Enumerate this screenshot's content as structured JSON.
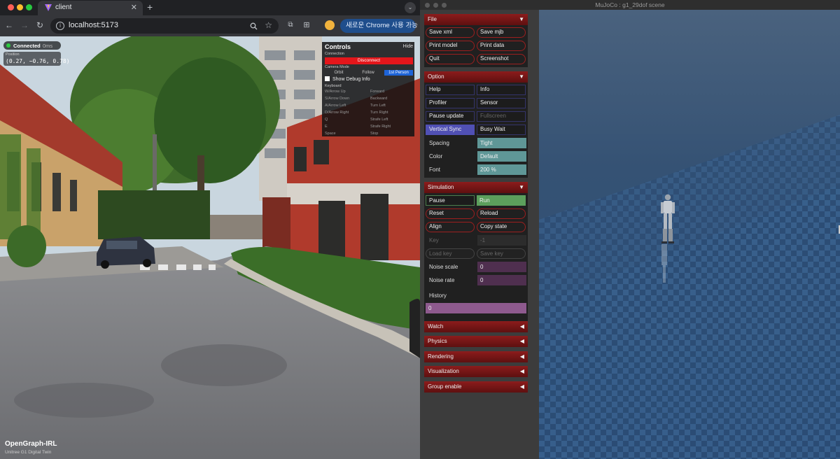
{
  "browser": {
    "tab_title": "client",
    "url": "localhost:5173",
    "update_button": "새로운 Chrome 사용 가능"
  },
  "app": {
    "status": {
      "label": "Connected",
      "latency": "0ms"
    },
    "position": {
      "label": "Position",
      "value": "(0.27, −0.76, 0.78)"
    },
    "controls": {
      "title": "Controls",
      "hide": "Hide",
      "connection_label": "Connection",
      "disconnect": "Disconnect",
      "camera_mode_label": "Camera Mode",
      "camera_modes": [
        "Orbit",
        "Follow",
        "1st Person"
      ],
      "active_camera": "1st Person",
      "debug_label": "Show Debug Info",
      "keyboard_label": "Keyboard",
      "keys": [
        {
          "key": "W/Arrow Up",
          "action": "Forward"
        },
        {
          "key": "S/Arrow Down",
          "action": "Backward"
        },
        {
          "key": "A/Arrow Left",
          "action": "Turn Left"
        },
        {
          "key": "D/Arrow Right",
          "action": "Turn Right"
        },
        {
          "key": "Q",
          "action": "Strafe Left"
        },
        {
          "key": "E",
          "action": "Strafe Right"
        },
        {
          "key": "Space",
          "action": "Stop"
        }
      ]
    },
    "brand": "OpenGraph-IRL",
    "brand_sub": "Unitree G1 Digital Twin"
  },
  "mujoco": {
    "window_title": "MuJoCo : g1_29dof scene",
    "file": {
      "header": "File",
      "buttons": [
        "Save xml",
        "Save mjb",
        "Print model",
        "Print data",
        "Quit",
        "Screenshot"
      ]
    },
    "option": {
      "header": "Option",
      "toggles": [
        "Help",
        "Info",
        "Profiler",
        "Sensor",
        "Pause update",
        "Fullscreen",
        "Vertical Sync",
        "Busy Wait"
      ],
      "spacing_label": "Spacing",
      "spacing_value": "Tight",
      "color_label": "Color",
      "color_value": "Default",
      "font_label": "Font",
      "font_value": "200 %"
    },
    "simulation": {
      "header": "Simulation",
      "pause": "Pause",
      "run": "Run",
      "reset": "Reset",
      "reload": "Reload",
      "align": "Align",
      "copy_state": "Copy state",
      "key_label": "Key",
      "key_value": "-1",
      "load_key": "Load key",
      "save_key": "Save key",
      "noise_scale_label": "Noise scale",
      "noise_scale_value": "0",
      "noise_rate_label": "Noise rate",
      "noise_rate_value": "0",
      "history_label": "History",
      "history_value": "0"
    },
    "collapsed_sections": [
      "Watch",
      "Physics",
      "Rendering",
      "Visualization",
      "Group enable"
    ],
    "colors": {
      "section_header": "#8c1c1c",
      "toggle_on": "#5050b4",
      "select": "#5f9797",
      "run": "#5c9f5c",
      "history": "#8e5a8e",
      "floor": "#2f5b8a"
    }
  }
}
